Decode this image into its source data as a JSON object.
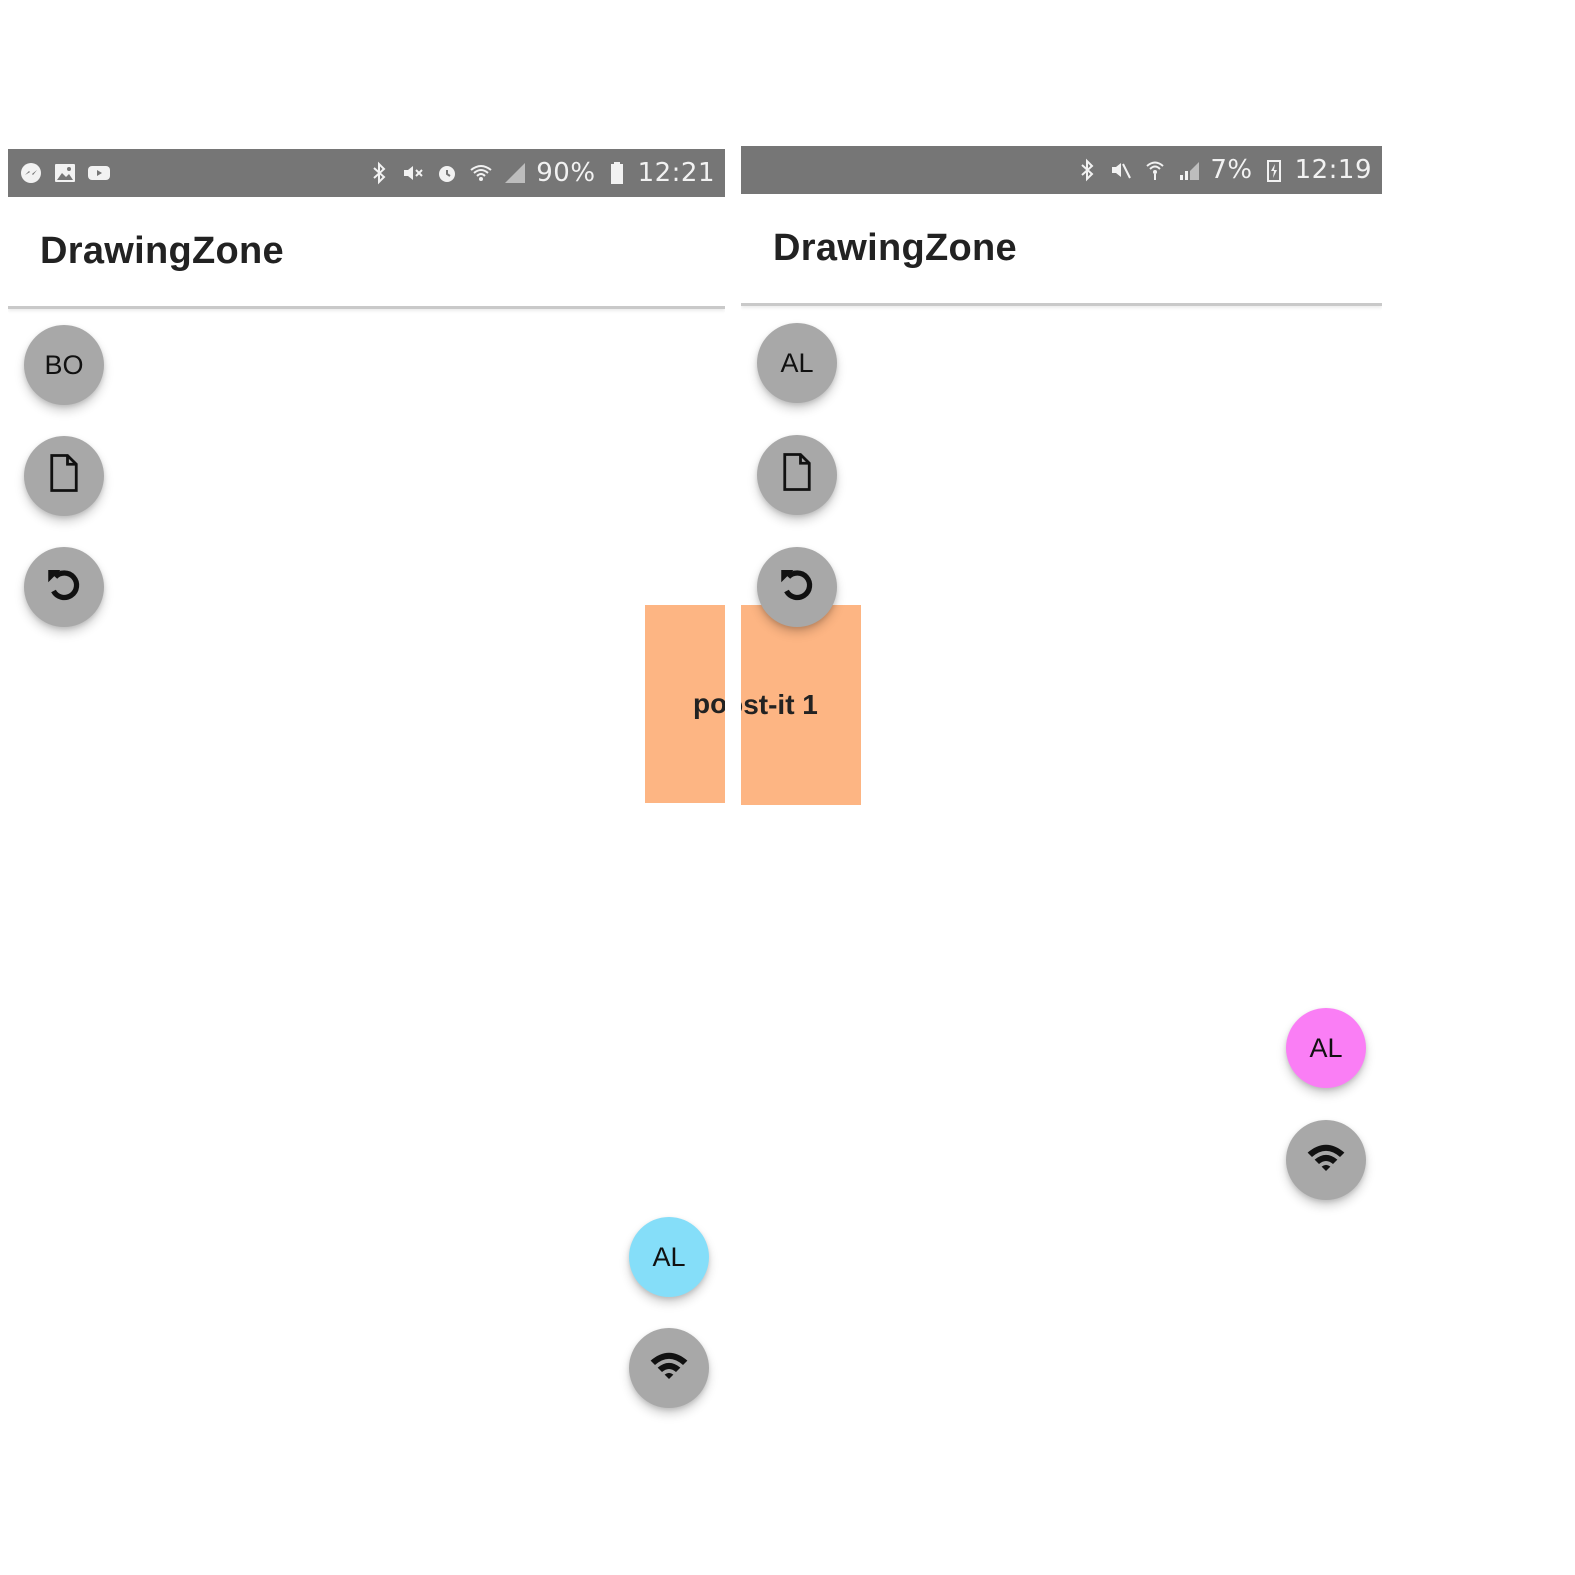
{
  "app_title": "DrawingZone",
  "left_screen": {
    "status": {
      "battery": "90%",
      "time": "12:21"
    },
    "user_initials": "BO",
    "remote_user_initials": "AL"
  },
  "right_screen": {
    "status": {
      "battery": "7%",
      "time": "12:19"
    },
    "user_initials": "AL",
    "remote_user_initials": "AL"
  },
  "postit": {
    "text": "post-it 1"
  },
  "colors": {
    "status_bar": "#767676",
    "fab_grey": "#a8a8a8",
    "remote_user_cyan": "#85def9",
    "remote_user_magenta": "#fa7ef5",
    "postit": "#fdb583"
  },
  "icons": [
    "messenger-icon",
    "gallery-icon",
    "youtube-icon",
    "bluetooth-icon",
    "mute-icon",
    "alarm-icon",
    "wifi-icon",
    "signal-icon",
    "battery-icon",
    "new-document-icon",
    "undo-icon"
  ]
}
